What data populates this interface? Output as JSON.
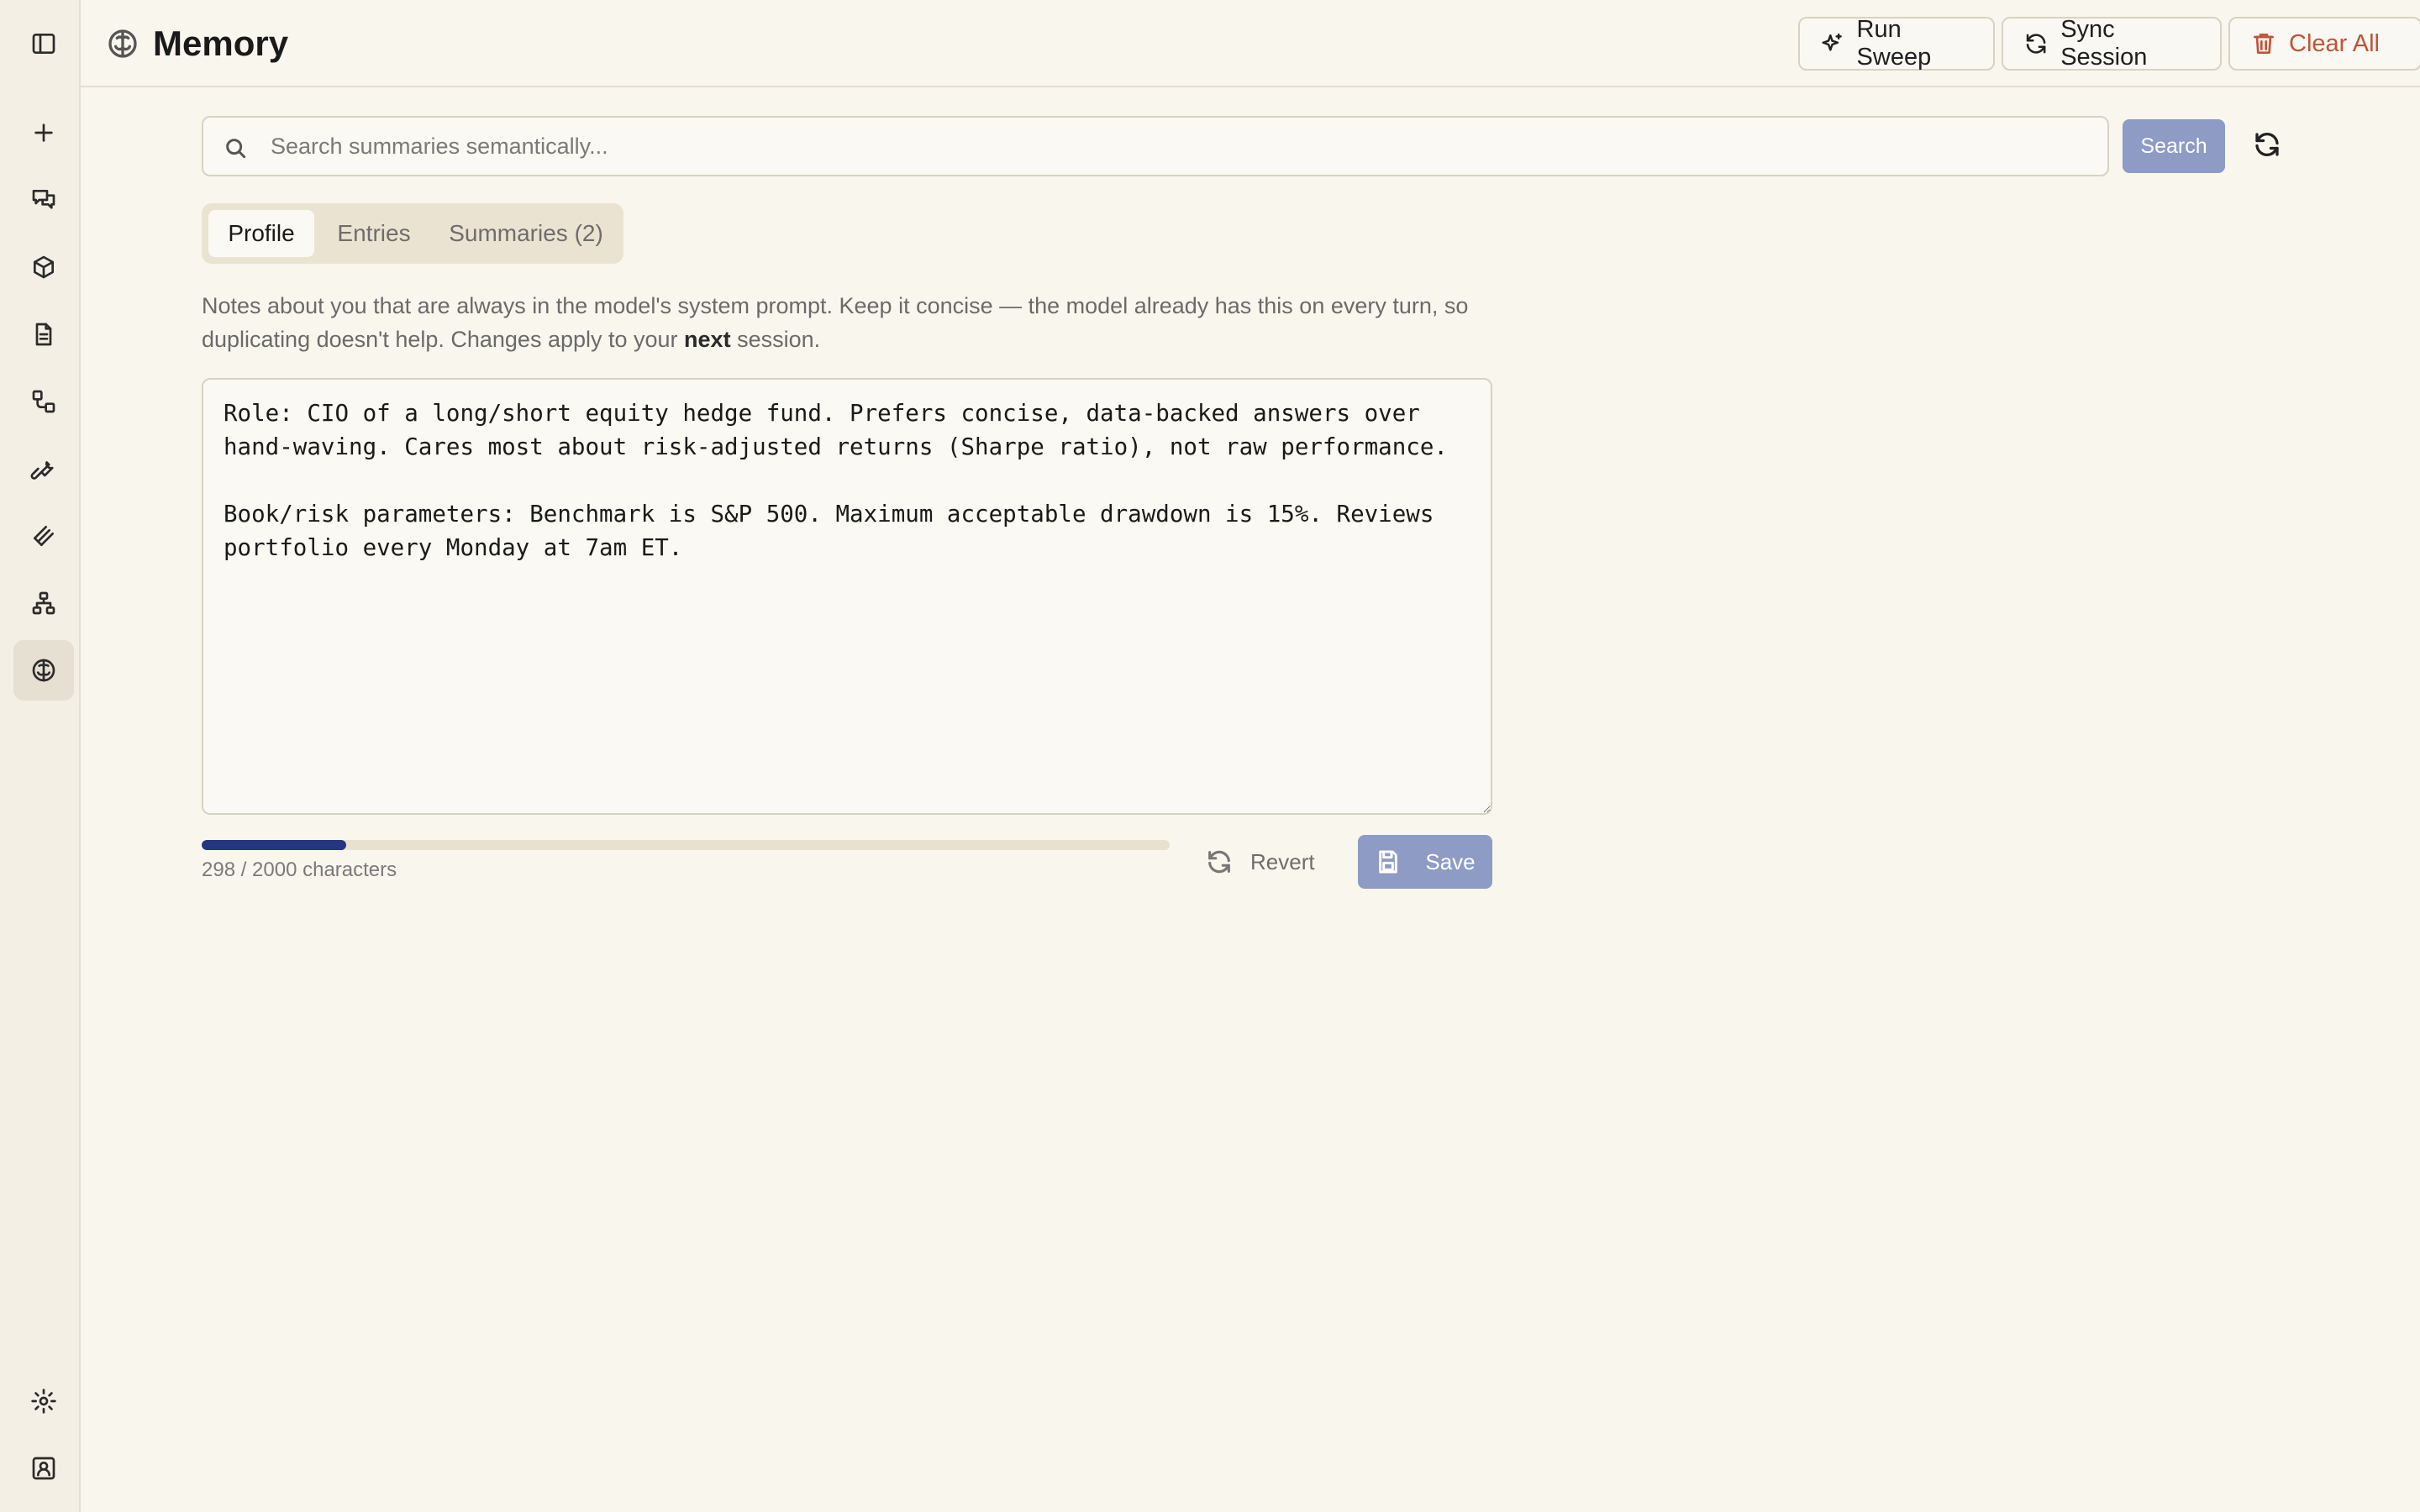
{
  "sidebar": {
    "items": [
      {
        "icon": "panel-toggle-icon"
      },
      {
        "icon": "plus-icon"
      },
      {
        "icon": "messages-icon"
      },
      {
        "icon": "box-icon"
      },
      {
        "icon": "document-icon"
      },
      {
        "icon": "workflow-icon"
      },
      {
        "icon": "wrench-icon"
      },
      {
        "icon": "layers-icon"
      },
      {
        "icon": "network-icon"
      },
      {
        "icon": "brain-icon",
        "active": true
      },
      {
        "icon": "settings-icon"
      },
      {
        "icon": "user-card-icon"
      }
    ]
  },
  "header": {
    "title": "Memory",
    "title_icon": "brain-icon",
    "run_sweep_label": "Run Sweep",
    "sync_session_label": "Sync Session",
    "clear_all_label": "Clear All",
    "danger_color": "#c0533a"
  },
  "search": {
    "placeholder": "Search summaries semantically...",
    "value": "",
    "button_label": "Search"
  },
  "tabs": [
    {
      "label": "Profile",
      "active": true
    },
    {
      "label": "Entries",
      "active": false
    },
    {
      "label": "Summaries (2)",
      "active": false
    }
  ],
  "profile": {
    "description_before": "Notes about you that are always in the model's system prompt. Keep it concise — the model already has this on every turn, so duplicating doesn't help. Changes apply to your ",
    "description_bold": "next",
    "description_after": " session.",
    "text": "Role: CIO of a long/short equity hedge fund. Prefers concise, data-backed answers over hand-waving. Cares most about risk-adjusted returns (Sharpe ratio), not raw performance.\n\nBook/risk parameters: Benchmark is S&P 500. Maximum acceptable drawdown is 15%. Reviews portfolio every Monday at 7am ET.",
    "char_count_label": "298 / 2000 characters",
    "progress_fraction": 0.149,
    "progress_color": "#24367f",
    "revert_label": "Revert",
    "save_label": "Save"
  },
  "colors": {
    "accent_button": "#8e9bc4",
    "background": "#f9f6ee"
  }
}
